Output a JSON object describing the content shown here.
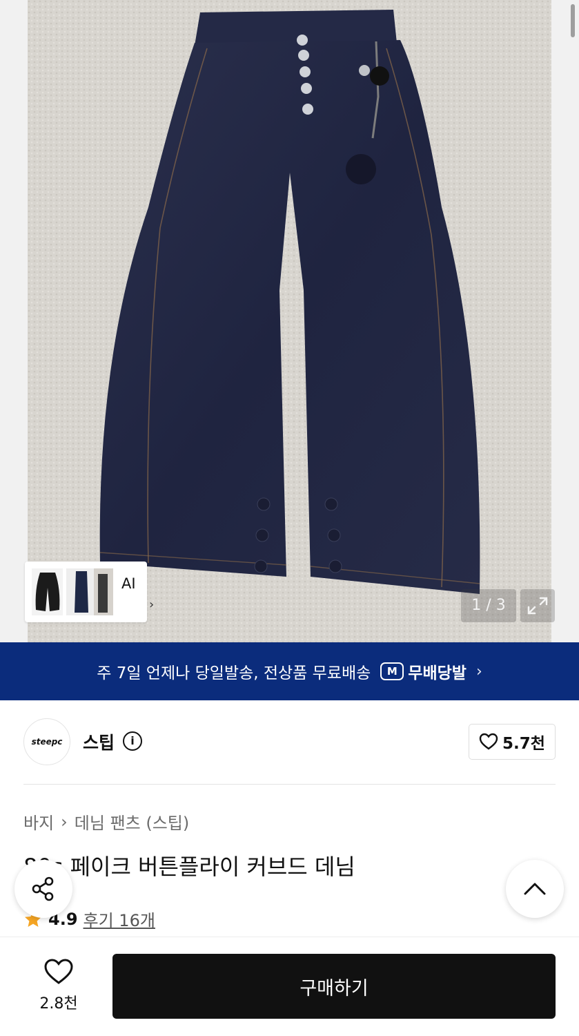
{
  "gallery": {
    "counter": "1 / 3",
    "ai_label": "AI",
    "ai_chevron": "›"
  },
  "banner": {
    "text": "주 7일 언제나 당일발송, 전상품 무료배송",
    "logo_letter": "M",
    "logo_text": "무배당발",
    "chevron": "›",
    "background": "#0b2c7c"
  },
  "store": {
    "logo_text": "steepc",
    "name": "스팁",
    "info_icon": "i",
    "like_count": "5.7천"
  },
  "product": {
    "breadcrumb": [
      "바지",
      "데님 팬츠 (스팁)"
    ],
    "breadcrumb_sep": "›",
    "title": "80s 페이크 버튼플라이 커브드 데님",
    "rating": "4.9",
    "reviews_label": "후기 16개",
    "star_color": "#f5a524"
  },
  "bottom_bar": {
    "wish_count": "2.8천",
    "buy_label": "구매하기"
  }
}
